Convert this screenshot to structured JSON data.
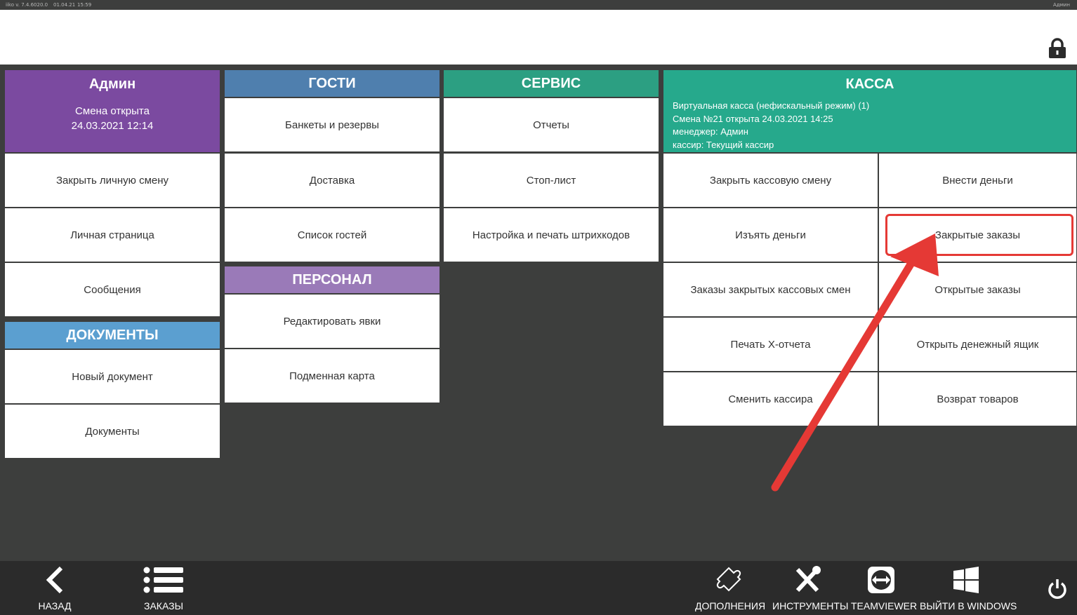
{
  "topbar": {
    "version": "iiko v. 7.4.6020.0",
    "date": "01.04.21",
    "time": "15:59",
    "user": "Админ"
  },
  "admin": {
    "title": "Админ",
    "status": "Смена открыта",
    "opened": "24.03.2021 12:14",
    "items": [
      "Закрыть личную смену",
      "Личная страница",
      "Сообщения"
    ]
  },
  "documents": {
    "title": "ДОКУМЕНТЫ",
    "items": [
      "Новый документ",
      "Документы"
    ]
  },
  "guests": {
    "title": "ГОСТИ",
    "items": [
      "Банкеты и резервы",
      "Доставка",
      "Список гостей"
    ]
  },
  "staff": {
    "title": "ПЕРСОНАЛ",
    "items": [
      "Редактировать явки",
      "Подменная карта"
    ]
  },
  "service": {
    "title": "СЕРВИС",
    "items": [
      "Отчеты",
      "Стоп-лист",
      "Настройка и печать штрихкодов"
    ]
  },
  "kassa": {
    "title": "КАССА",
    "info": [
      "Виртуальная касса (нефискальный режим) (1)",
      "Смена №21 открыта 24.03.2021 14:25",
      "менеджер: Админ",
      "кассир: Текущий кассир"
    ],
    "left": [
      "Закрыть кассовую смену",
      "Изъять деньги",
      "Заказы закрытых кассовых смен",
      "Печать X-отчета",
      "Сменить кассира"
    ],
    "right": [
      "Внести деньги",
      "Закрытые заказы",
      "Открытые заказы",
      "Открыть денежный ящик",
      "Возврат товаров"
    ]
  },
  "footer": {
    "back": "НАЗАД",
    "orders": "ЗАКАЗЫ",
    "addons": "ДОПОЛНЕНИЯ",
    "tools": "ИНСТРУМЕНТЫ",
    "teamviewer": "TEAMVIEWER",
    "exit": "ВЫЙТИ В WINDOWS"
  },
  "colors": {
    "admin": "#7b4aa0",
    "documents": "#5b9fd0",
    "guests": "#4f7fae",
    "staff": "#9a7ab8",
    "service": "#2c9f82",
    "kassa": "#26a98c",
    "highlight": "#e53935"
  }
}
